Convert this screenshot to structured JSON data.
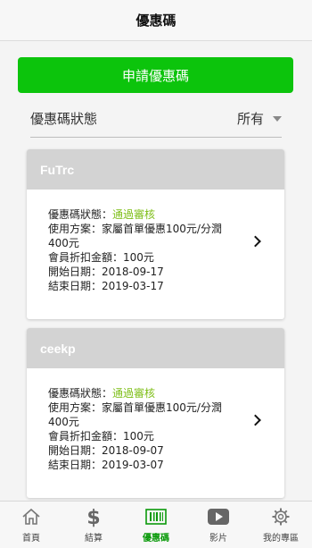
{
  "header": {
    "title": "優惠碼"
  },
  "apply_button": {
    "label": "申請優惠碼"
  },
  "filter": {
    "label": "優惠碼狀態",
    "selected": "所有"
  },
  "coupons": [
    {
      "code": "FuTrc",
      "status_label": "優惠碼狀態：",
      "status_value": "通過審核",
      "plan_line1": "使用方案：家屬首單優惠100元/分潤",
      "plan_line2": "400元",
      "discount": "會員折扣金額：100元",
      "start": "開始日期：2018-09-17",
      "end": "結束日期：2019-03-17"
    },
    {
      "code": "ceekp",
      "status_label": "優惠碼狀態：",
      "status_value": "通過審核",
      "plan_line1": "使用方案：家屬首單優惠100元/分潤",
      "plan_line2": "400元",
      "discount": "會員折扣金額：100元",
      "start": "開始日期：2018-09-07",
      "end": "結束日期：2019-03-07"
    }
  ],
  "tabbar": {
    "items": [
      {
        "label": "首頁",
        "icon": "home-icon"
      },
      {
        "label": "結算",
        "icon": "dollar-icon"
      },
      {
        "label": "優惠碼",
        "icon": "barcode-icon",
        "active": true
      },
      {
        "label": "影片",
        "icon": "play-icon"
      },
      {
        "label": "我的專區",
        "icon": "gear-icon"
      }
    ]
  },
  "colors": {
    "accent": "#0cc40c",
    "status_ok": "#7fbf1a",
    "card_header": "#d3d3d3"
  }
}
